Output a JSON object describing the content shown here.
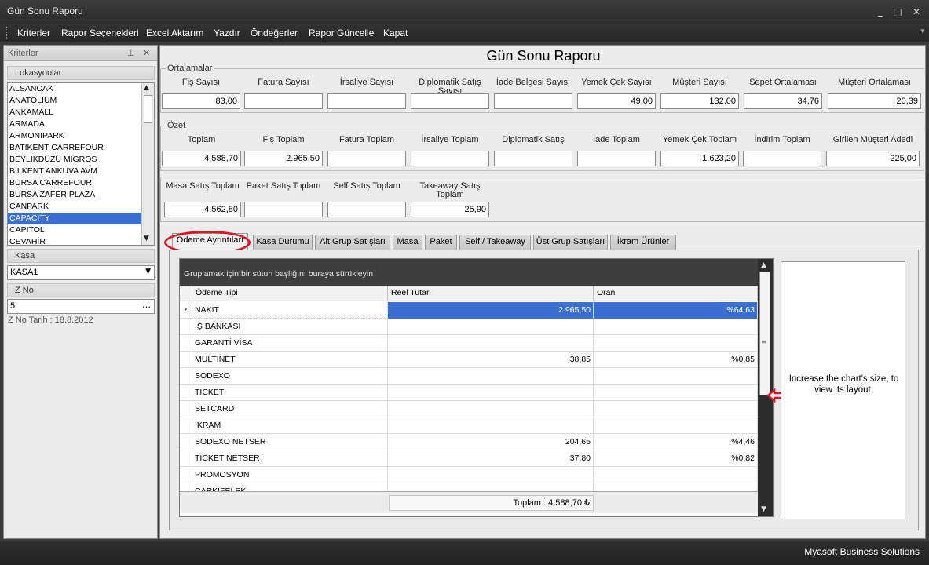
{
  "window": {
    "title": "Gün Sonu Raporu"
  },
  "menu": [
    "Kriterler",
    "Rapor Seçenekleri",
    "Excel Aktarım",
    "Yazdır",
    "Öndeğerler",
    "Rapor Güncelle",
    "Kapat"
  ],
  "left_panel": {
    "title": "Kriterler",
    "locations_header": "Lokasyonlar",
    "locations": [
      "ALSANCAK",
      "ANATOLIUM",
      "ANKAMALL",
      "ARMADA",
      "ARMONIPARK",
      "BATIKENT CARREFOUR",
      "BEYLİKDÜZÜ MİGROS",
      "BİLKENT ANKUVA AVM",
      "BURSA CARREFOUR",
      "BURSA ZAFER PLAZA",
      "CANPARK",
      "CAPACITY",
      "CAPITOL",
      "CEVAHİR"
    ],
    "selected_location": "CAPACITY",
    "kasa_header": "Kasa",
    "kasa_value": "KASA1",
    "zno_header": "Z No",
    "zno_value": "5",
    "zno_date": "Z No Tarih : 18.8.2012"
  },
  "report": {
    "title": "Gün Sonu Raporu",
    "ortalamalar": {
      "legend": "Ortalamalar",
      "labels": [
        "Fiş Sayısı",
        "Fatura Sayısı",
        "İrsaliye Sayısı",
        "Diplomatik Satış Sayısı",
        "İade Belgesi Sayısı",
        "Yemek Çek Sayısı",
        "Müşteri Sayısı",
        "Sepet Ortalaması",
        "Müşteri Ortalaması"
      ],
      "values": [
        "83,00",
        "",
        "",
        "",
        "",
        "49,00",
        "132,00",
        "34,76",
        "20,39"
      ]
    },
    "ozet": {
      "legend": "Özet",
      "labels": [
        "Toplam",
        "Fiş Toplam",
        "Fatura Toplam",
        "İrsaliye Toplam",
        "Diplomatik Satış",
        "İade Toplam",
        "Yemek Çek Toplam",
        "İndirim Toplam",
        "Girilen Müşteri Adedi"
      ],
      "values": [
        "4.588,70",
        "2.965,50",
        "",
        "",
        "",
        "",
        "1.623,20",
        "",
        "225,00"
      ]
    },
    "satis": {
      "labels": [
        "Masa Satış Toplam",
        "Paket Satış Toplam",
        "Self Satış Toplam",
        "Takeaway Satış Toplam"
      ],
      "values": [
        "4.562,80",
        "",
        "",
        "25,90"
      ]
    }
  },
  "tabs": [
    "Ödeme Ayrıntıları",
    "Kasa Durumu",
    "Alt Grup Satışları",
    "Masa",
    "Paket",
    "Self / Takeaway",
    "Üst Grup Satışları",
    "İkram Ürünler"
  ],
  "active_tab": "Ödeme Ayrıntıları",
  "grid": {
    "group_hint": "Gruplamak için bir sütun başlığını buraya sürükleyin",
    "columns": [
      "Ödeme Tipi",
      "Reel Tutar",
      "Oran"
    ],
    "rows": [
      [
        "NAKIT",
        "2.965,50",
        "%64,63"
      ],
      [
        "İŞ BANKASI",
        "",
        ""
      ],
      [
        "GARANTİ VİSA",
        "",
        ""
      ],
      [
        "MULTINET",
        "38,85",
        "%0,85"
      ],
      [
        "SODEXO",
        "",
        ""
      ],
      [
        "TICKET",
        "",
        ""
      ],
      [
        "SETCARD",
        "",
        ""
      ],
      [
        "İKRAM",
        "",
        ""
      ],
      [
        "SODEXO NETSER",
        "204,65",
        "%4,46"
      ],
      [
        "TICKET NETSER",
        "37,80",
        "%0,82"
      ],
      [
        "PROMOSYON",
        "",
        ""
      ],
      [
        "CARKIFELEK",
        "",
        ""
      ]
    ],
    "total": "Toplam : 4.588,70 ₺"
  },
  "chart": {
    "message": "Increase the chart's size, to view its layout."
  },
  "status": {
    "company": "Myasoft Business Solutions"
  },
  "colors": {
    "selection": "#3a6fd0",
    "highlight_ring": "#e0141e",
    "dark_chrome": "#2b2b2b"
  }
}
